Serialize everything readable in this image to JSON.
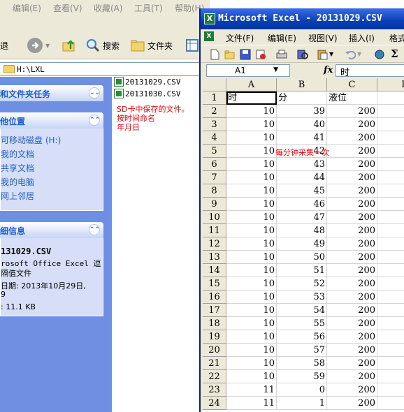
{
  "explorer": {
    "menus": [
      "编辑(E)",
      "查看(V)",
      "收藏(A)",
      "工具(T)",
      "帮助(H)"
    ],
    "toolbar": {
      "back_label": "退",
      "search_label": "搜索",
      "folders_label": "文件夹"
    },
    "address": "H:\\LXL",
    "tasks_title": "和文件夹任务",
    "places": {
      "title": "他位置",
      "items": [
        "可移动磁盘 (H:)",
        "我的文档",
        "共享文档",
        "我的电脑",
        "网上邻居"
      ]
    },
    "details": {
      "title": "细信息",
      "filename": "131029.CSV",
      "type_line1": "rosoft Office Excel 逗",
      "type_line2": "隔值文件",
      "date_line1": "日期: 2013年10月29日,",
      "date_line2": "9",
      "size_line": ": 11.1 KB"
    },
    "files": [
      "20131029.CSV",
      "20131030.CSV"
    ],
    "annotation": [
      "SD卡中保存的文件。",
      "按时间命名",
      "年月日"
    ]
  },
  "excel": {
    "title": "Microsoft Excel - 20131029.CSV",
    "menus": [
      "文件(F)",
      "编辑(E)",
      "视图(V)",
      "插入(I)",
      "格式"
    ],
    "namebox": "A1",
    "fx": "fx",
    "formula_value": "时",
    "columns": [
      "A",
      "B",
      "C",
      "D"
    ],
    "headers": [
      "时",
      "分",
      "液位"
    ],
    "rows": [
      [
        10,
        39,
        200
      ],
      [
        10,
        40,
        200
      ],
      [
        10,
        41,
        200
      ],
      [
        10,
        42,
        200
      ],
      [
        10,
        43,
        200
      ],
      [
        10,
        44,
        200
      ],
      [
        10,
        45,
        200
      ],
      [
        10,
        46,
        200
      ],
      [
        10,
        47,
        200
      ],
      [
        10,
        48,
        200
      ],
      [
        10,
        49,
        200
      ],
      [
        10,
        50,
        200
      ],
      [
        10,
        51,
        200
      ],
      [
        10,
        52,
        200
      ],
      [
        10,
        53,
        200
      ],
      [
        10,
        54,
        200
      ],
      [
        10,
        55,
        200
      ],
      [
        10,
        56,
        200
      ],
      [
        10,
        57,
        200
      ],
      [
        10,
        58,
        200
      ],
      [
        10,
        59,
        200
      ],
      [
        11,
        0,
        200
      ],
      [
        11,
        1,
        200
      ]
    ],
    "note": "每分钟采集一次"
  },
  "colors": {
    "excel_title": "#0a3fb8",
    "taskpane": "#6f8fe3",
    "annotation": "#e8000a",
    "link": "#215dc6"
  }
}
